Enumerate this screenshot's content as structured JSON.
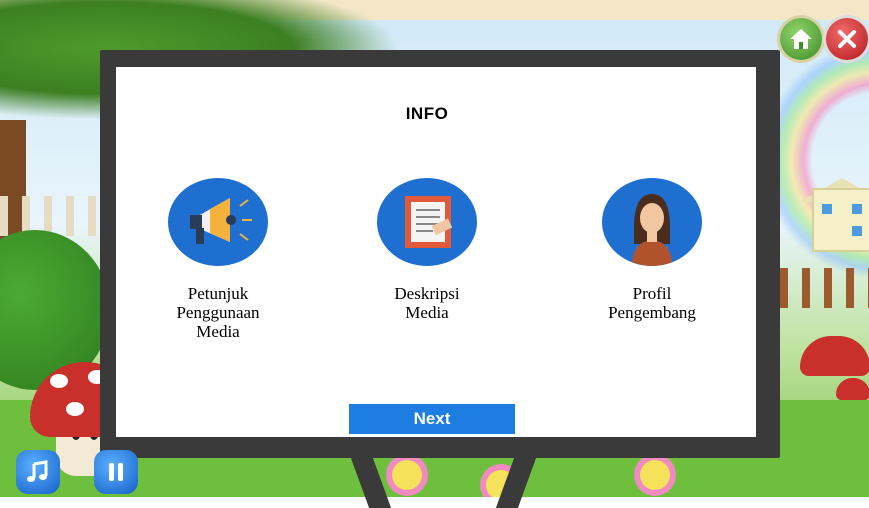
{
  "info_panel": {
    "title": "INFO",
    "items": [
      {
        "label_lines": [
          "Petunjuk",
          "Penggunaan",
          "Media"
        ],
        "icon": "megaphone-icon"
      },
      {
        "label_lines": [
          "Deskripsi",
          "Media"
        ],
        "icon": "clipboard-icon"
      },
      {
        "label_lines": [
          "Profil",
          "Pengembang"
        ],
        "icon": "person-icon"
      }
    ],
    "next_label": "Next"
  },
  "top_controls": {
    "home_icon": "home-icon",
    "close_icon": "close-icon"
  },
  "bottom_controls": {
    "music_icon": "music-icon",
    "pause_icon": "pause-icon"
  },
  "colors": {
    "accent_blue": "#1e7de0",
    "icon_circle": "#1e6fd0",
    "board": "#3a3a3a",
    "close_red": "#c62026",
    "home_green": "#4f9b2c"
  }
}
